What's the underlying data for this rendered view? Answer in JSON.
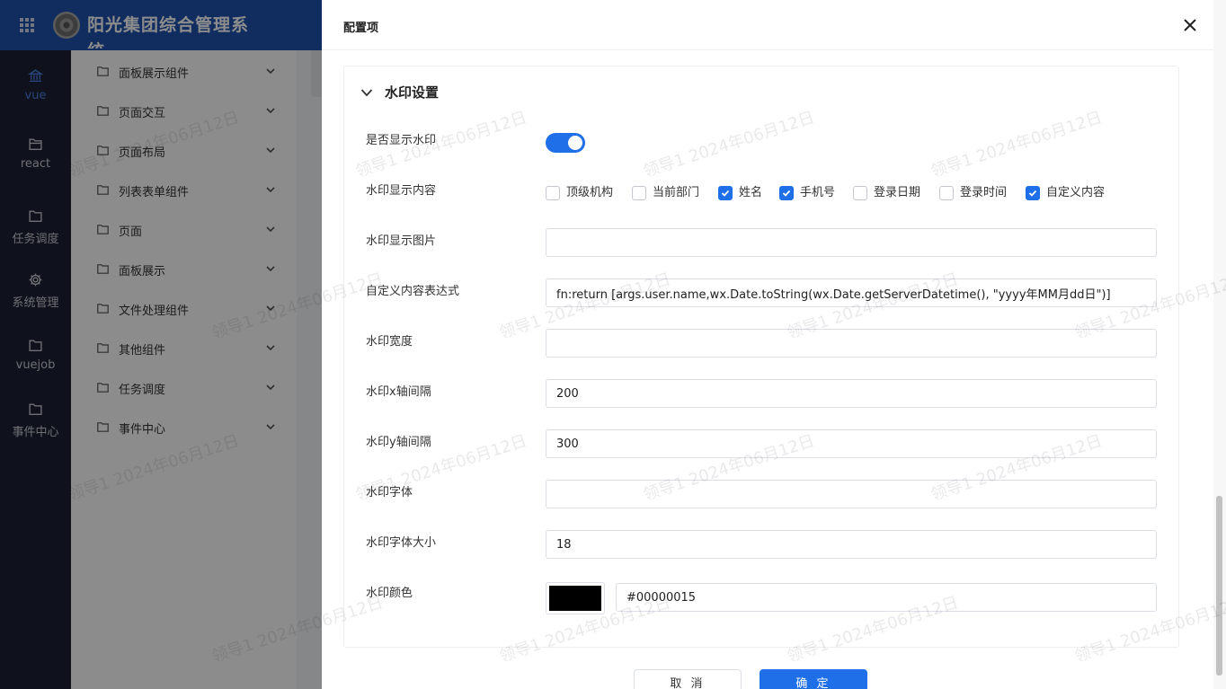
{
  "app": {
    "title": "阳光集团综合管理系统"
  },
  "leftbar": {
    "items": [
      {
        "label": "vue",
        "icon": "bank-icon",
        "active": true
      },
      {
        "label": "react",
        "icon": "folder-open-icon"
      },
      {
        "label": "任务调度",
        "icon": "folder-icon"
      },
      {
        "label": "系统管理",
        "icon": "gear-icon"
      },
      {
        "label": "vuejob",
        "icon": "folder-icon"
      },
      {
        "label": "事件中心",
        "icon": "folder-icon"
      }
    ]
  },
  "submenu": {
    "items": [
      {
        "label": "面板展示组件"
      },
      {
        "label": "页面交互"
      },
      {
        "label": "页面布局"
      },
      {
        "label": "列表表单组件"
      },
      {
        "label": "页面"
      },
      {
        "label": "面板展示"
      },
      {
        "label": "文件处理组件"
      },
      {
        "label": "其他组件"
      },
      {
        "label": "任务调度"
      },
      {
        "label": "事件中心"
      }
    ]
  },
  "drawer": {
    "title": "配置项",
    "section_title": "水印设置",
    "fields": {
      "show_label": "是否显示水印",
      "show_on": true,
      "content_label": "水印显示内容",
      "content_options": [
        {
          "label": "顶级机构",
          "checked": false
        },
        {
          "label": "当前部门",
          "checked": false
        },
        {
          "label": "姓名",
          "checked": true
        },
        {
          "label": "手机号",
          "checked": true
        },
        {
          "label": "登录日期",
          "checked": false
        },
        {
          "label": "登录时间",
          "checked": false
        },
        {
          "label": "自定义内容",
          "checked": true
        }
      ],
      "image_label": "水印显示图片",
      "image_value": "",
      "expr_label": "自定义内容表达式",
      "expr_value": "fn:return [args.user.name,wx.Date.toString(wx.Date.getServerDatetime(), \"yyyy年MM月dd日\")]",
      "width_label": "水印宽度",
      "width_value": "",
      "xgap_label": "水印x轴间隔",
      "xgap_value": "200",
      "ygap_label": "水印y轴间隔",
      "ygap_value": "300",
      "font_label": "水印字体",
      "font_value": "",
      "fontsize_label": "水印字体大小",
      "fontsize_value": "18",
      "color_label": "水印颜色",
      "color_value": "#00000015"
    },
    "buttons": {
      "cancel": "取 消",
      "ok": "确 定"
    }
  },
  "watermark": {
    "text": "领导1 2024年06月12日"
  },
  "colors": {
    "brand": "#1f52b0",
    "accent": "#1f6fe8",
    "sidebar": "#1c2236"
  }
}
